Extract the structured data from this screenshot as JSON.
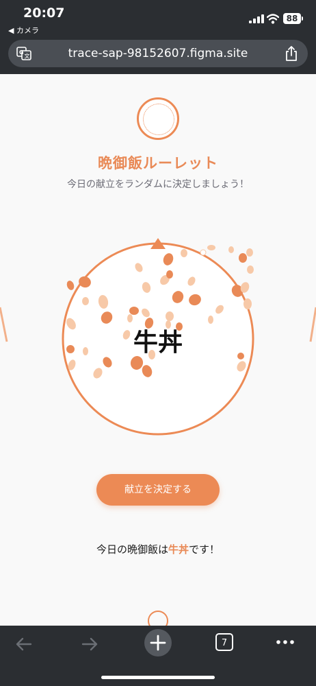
{
  "status_bar": {
    "time": "20:07",
    "back_app": "◀ カメラ",
    "battery": "88"
  },
  "browser": {
    "url": "trace-sap-98152607.figma.site",
    "tab_count": "7"
  },
  "app": {
    "title": "晩御飯ルーレット",
    "subtitle": "今日の献立をランダムに決定しましょう！",
    "wheel_label": "牛丼",
    "decide_button": "献立を決定する",
    "result_prefix": "今日の晩御飯は",
    "result_food": "牛丼",
    "result_suffix": "です！"
  },
  "colors": {
    "accent": "#ec8a55",
    "title": "#e98a57",
    "petal_light": "#f7c9a8",
    "petal_dark": "#e98a57"
  },
  "icons": [
    "translate-icon",
    "share-icon",
    "back-arrow-icon",
    "forward-arrow-icon",
    "new-tab-plus-icon",
    "tabs-icon",
    "more-icon"
  ]
}
